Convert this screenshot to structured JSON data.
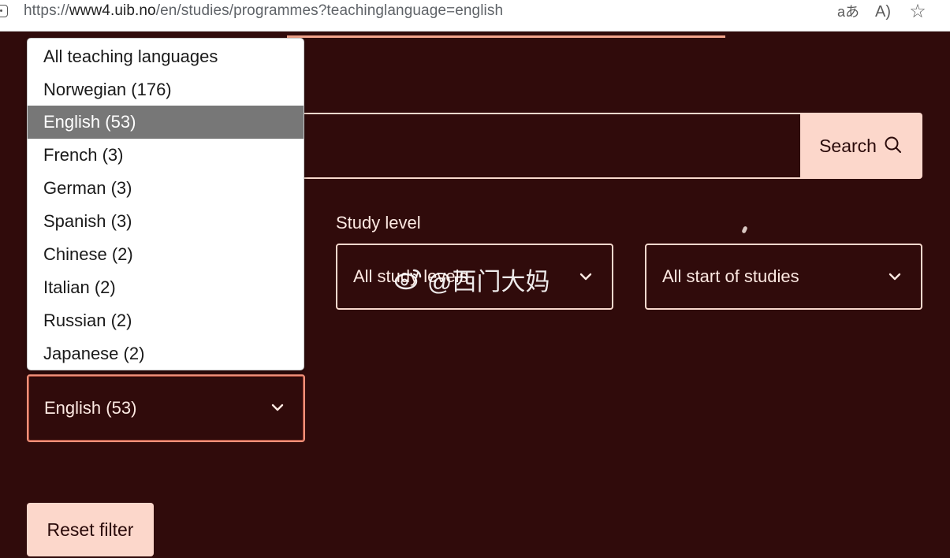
{
  "browser": {
    "url_prefix": "https://",
    "url_host": "www4.uib.no",
    "url_path": "/en/studies/programmes?teachinglanguage=english",
    "icons": [
      "lock-icon",
      "translate-icon",
      "read-aloud-icon",
      "favorite-star-icon"
    ]
  },
  "search": {
    "input_value": "",
    "button_label": "Search",
    "icon": "search-icon"
  },
  "study_level": {
    "label": "Study level",
    "selected": "All study levels"
  },
  "start_of_studies": {
    "selected": "All start of studies"
  },
  "teaching_language": {
    "selected": "English (53)",
    "options": [
      "All teaching languages",
      "Norwegian (176)",
      "English (53)",
      "French (3)",
      "German (3)",
      "Spanish (3)",
      "Chinese (2)",
      "Italian (2)",
      "Russian (2)",
      "Japanese (2)"
    ],
    "highlighted_index": 2
  },
  "reset": {
    "label": "Reset filter"
  },
  "watermark": {
    "text": "@西门大妈",
    "icon": "weibo-icon"
  },
  "colors": {
    "background": "#300b0b",
    "button_bg": "#fcd7cb",
    "border": "#f7d8cd",
    "focus_border": "#f2917a",
    "highlight": "#777777"
  }
}
